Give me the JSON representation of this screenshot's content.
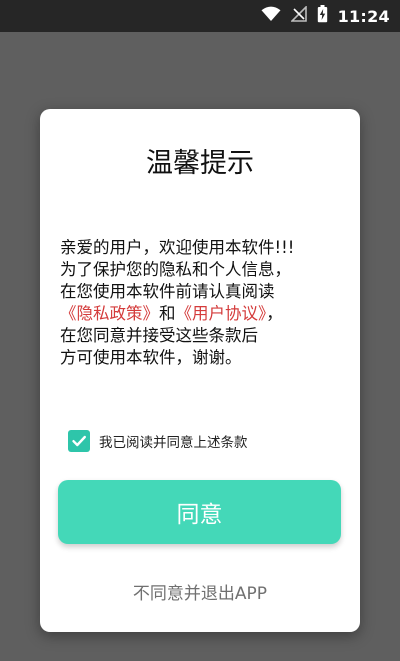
{
  "status_bar": {
    "time": "11:24",
    "icons": [
      "wifi-icon",
      "signal-muted-icon",
      "battery-charging-icon"
    ]
  },
  "dialog": {
    "title": "温馨提示",
    "body": {
      "line1": "亲爱的用户，欢迎使用本软件!!!",
      "line2": "为了保护您的隐私和个人信息，",
      "line3": "在您使用本软件前请认真阅读",
      "privacy_link": "《隐私政策》",
      "and_text": "和",
      "agreement_link": "《用户协议》",
      "line4_suffix": "，",
      "line5": "在您同意并接受这些条款后",
      "line6": "方可使用本软件，谢谢。"
    },
    "consent": {
      "checked": true,
      "label": "我已阅读并同意上述条款"
    },
    "agree_button": "同意",
    "exit_link": "不同意并退出APP"
  },
  "colors": {
    "accent": "#44d8b8",
    "checkbox": "#2ec5aa",
    "link": "#d43b3b",
    "overlay": "#5f5f5f"
  }
}
